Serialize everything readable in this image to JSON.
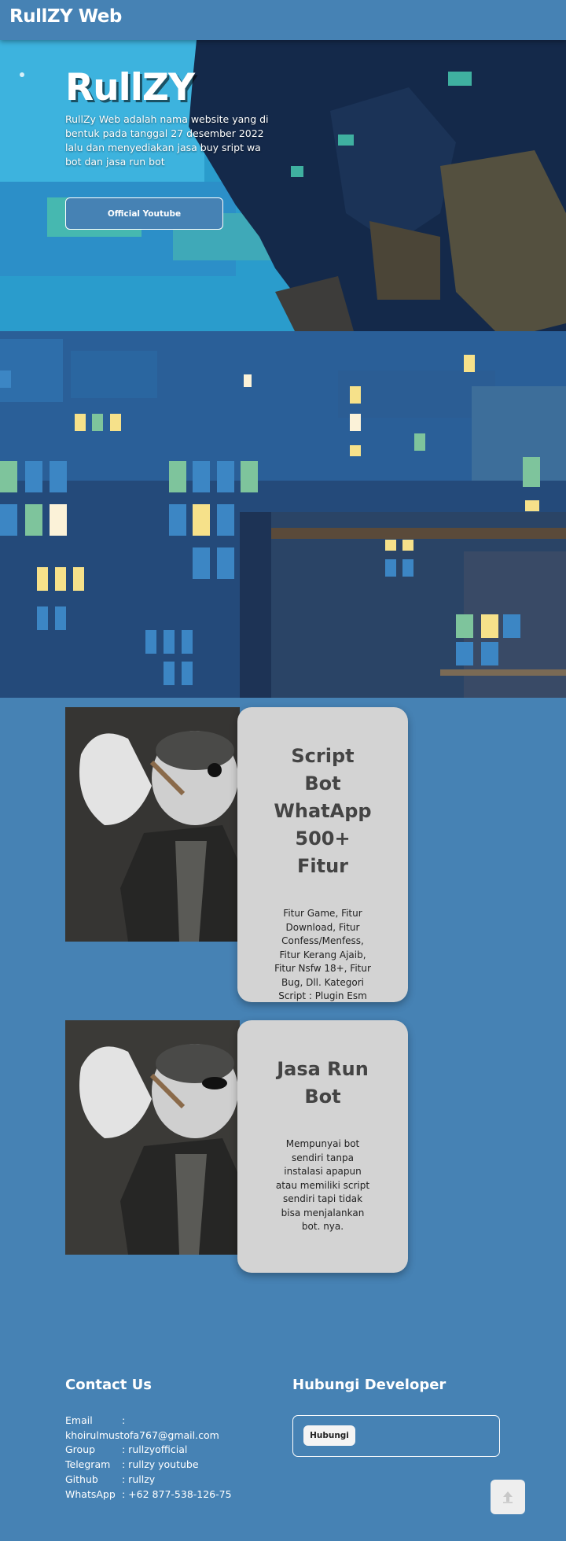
{
  "navbar": {
    "brand": "RullZY Web"
  },
  "hero": {
    "title": "RullZY",
    "description": "RullZy Web adalah nama website yang di bentuk pada tanggal 27 desember 2022 lalu dan menyediakan jasa buy sript wa bot dan jasa run bot",
    "button_label": "Official Youtube"
  },
  "cards": [
    {
      "title": "Script Bot WhatApp 500+ Fitur",
      "text": "Fitur Game, Fitur Download, Fitur Confess/Menfess, Fitur Kerang Ajaib, Fitur Nsfw 18+, Fitur Bug, Dll. Kategori Script : Plugin Esm"
    },
    {
      "title": "Jasa Run Bot",
      "text": "Mempunyai bot sendiri tanpa instalasi apapun atau memiliki script sendiri tapi tidak bisa menjalankan bot. nya."
    }
  ],
  "contact": {
    "title": "Contact Us",
    "rows": [
      {
        "key": "Email",
        "value": ": khoirulmustofa767@gmail.com"
      },
      {
        "key": "Group",
        "value": ": rullzyofficial"
      },
      {
        "key": "Telegram",
        "value": ": rullzy youtube"
      },
      {
        "key": "Github",
        "value": ": rullzy"
      },
      {
        "key": "WhatsApp",
        "value": ": +62 877-538-126-75"
      }
    ]
  },
  "developer": {
    "title": "Hubungi Developer",
    "button_label": "Hubungi"
  },
  "icons": {
    "scroll_top": "arrow-up-icon"
  },
  "colors": {
    "background": "#4682b4",
    "card": "#d3d3d3"
  }
}
